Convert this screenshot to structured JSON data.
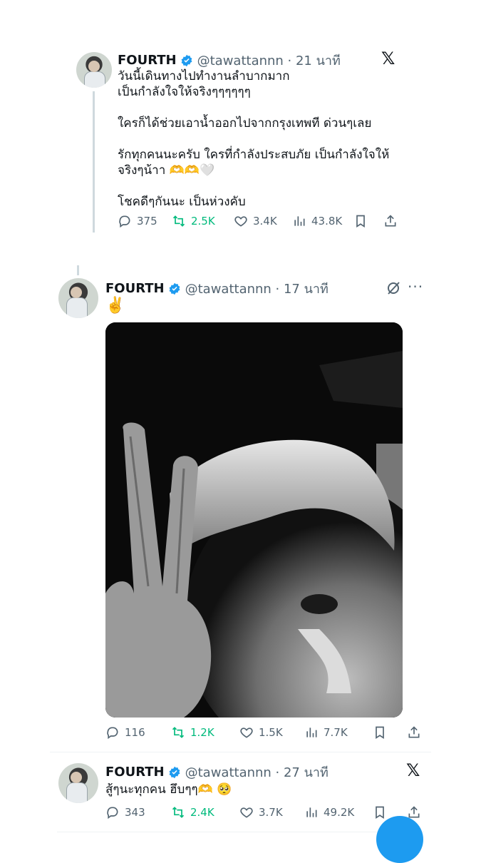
{
  "tweets": [
    {
      "name": "FOURTH",
      "handle": "@tawattannn · 21 นาที",
      "lines": "วันนี้เดินทางไปทำงานลำบากมาก\nเป็นกำลังใจให้จริงๆๆๆๆๆๆ\n\nใครก็ได้ช่วยเอาน้ำออกไปจากกรุงเทพที ด่วนๆเลย\n\nรักทุกคนนะครับ ใครที่กำลังประสบภัย เป็นกำลังใจให้\nจริงๆน้าา 🫶🫶🤍\n\nโชคดีๆกันนะ เป็นห่วงคับ",
      "replies": "375",
      "reposts": "2.5K",
      "likes": "3.4K",
      "views": "43.8K"
    },
    {
      "name": "FOURTH",
      "handle": "@tawattannn · 17 นาที",
      "lines": "✌️",
      "replies": "116",
      "reposts": "1.2K",
      "likes": "1.5K",
      "views": "7.7K"
    },
    {
      "name": "FOURTH",
      "handle": "@tawattannn · 27 นาที",
      "lines": "สู้ๆนะทุกคน ฮึบๆๆ🫶 🥺",
      "replies": "343",
      "reposts": "2.4K",
      "likes": "3.7K",
      "views": "49.2K"
    }
  ],
  "colors": {
    "accent": "#1d9bf0",
    "repost": "#00ba7c",
    "muted": "#536471"
  },
  "icons": [
    "verified-badge-icon",
    "reply-icon",
    "repost-icon",
    "like-icon",
    "views-icon",
    "bookmark-icon",
    "share-icon",
    "x-logo-icon",
    "grok-icon",
    "more-icon"
  ]
}
